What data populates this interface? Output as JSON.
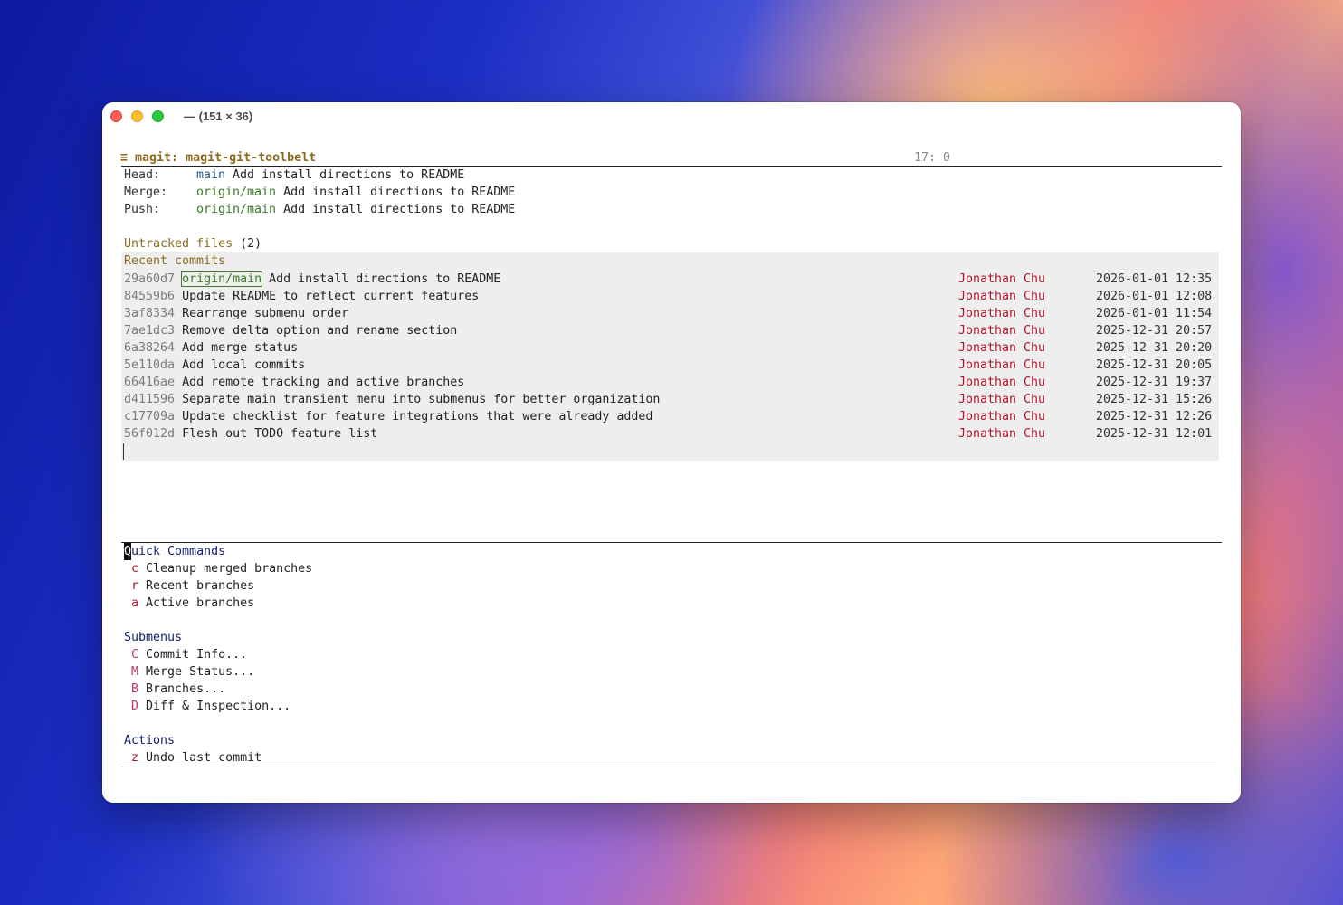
{
  "window": {
    "title": "— (151 × 36)"
  },
  "modeline": {
    "icon": "≡",
    "buffer": "magit: magit-git-toolbelt",
    "position": "17: 0"
  },
  "refs": {
    "head": {
      "label": "Head:",
      "branch": "main",
      "message": "Add install directions to README"
    },
    "merge": {
      "label": "Merge:",
      "branch": "origin/main",
      "message": "Add install directions to README"
    },
    "push": {
      "label": "Push:",
      "branch": "origin/main",
      "message": "Add install directions to README"
    }
  },
  "sections": {
    "untracked_title": "Untracked files",
    "untracked_count": "(2)",
    "recent_title": "Recent commits"
  },
  "commits": [
    {
      "hash": "29a60d7",
      "ref": "origin/main",
      "message": "Add install directions to README",
      "author": "Jonathan Chu",
      "date": "2026-01-01 12:35"
    },
    {
      "hash": "84559b6",
      "ref": "",
      "message": "Update README to reflect current features",
      "author": "Jonathan Chu",
      "date": "2026-01-01 12:08"
    },
    {
      "hash": "3af8334",
      "ref": "",
      "message": "Rearrange submenu order",
      "author": "Jonathan Chu",
      "date": "2026-01-01 11:54"
    },
    {
      "hash": "7ae1dc3",
      "ref": "",
      "message": "Remove delta option and rename section",
      "author": "Jonathan Chu",
      "date": "2025-12-31 20:57"
    },
    {
      "hash": "6a38264",
      "ref": "",
      "message": "Add merge status",
      "author": "Jonathan Chu",
      "date": "2025-12-31 20:20"
    },
    {
      "hash": "5e110da",
      "ref": "",
      "message": "Add local commits",
      "author": "Jonathan Chu",
      "date": "2025-12-31 20:05"
    },
    {
      "hash": "66416ae",
      "ref": "",
      "message": "Add remote tracking and active branches",
      "author": "Jonathan Chu",
      "date": "2025-12-31 19:37"
    },
    {
      "hash": "d411596",
      "ref": "",
      "message": "Separate main transient menu into submenus for better organization",
      "author": "Jonathan Chu",
      "date": "2025-12-31 15:26"
    },
    {
      "hash": "c17709a",
      "ref": "",
      "message": "Update checklist for feature integrations that were already added",
      "author": "Jonathan Chu",
      "date": "2025-12-31 12:26"
    },
    {
      "hash": "56f012d",
      "ref": "",
      "message": "Flesh out TODO feature list",
      "author": "Jonathan Chu",
      "date": "2025-12-31 12:01"
    }
  ],
  "transient": {
    "quick_title_first": "Q",
    "quick_title_rest": "uick Commands",
    "quick": [
      {
        "key": "c",
        "label": "Cleanup merged branches"
      },
      {
        "key": "r",
        "label": "Recent branches"
      },
      {
        "key": "a",
        "label": "Active branches"
      }
    ],
    "submenus_title": "Submenus",
    "submenus": [
      {
        "key": "C",
        "label": "Commit Info..."
      },
      {
        "key": "M",
        "label": "Merge Status..."
      },
      {
        "key": "B",
        "label": "Branches..."
      },
      {
        "key": "D",
        "label": "Diff & Inspection..."
      }
    ],
    "actions_title": "Actions",
    "actions": [
      {
        "key": "z",
        "label": "Undo last commit"
      }
    ]
  },
  "colors": {
    "author": "#b3142a",
    "section_heading": "#8b6a1e",
    "transient_heading": "#15206e",
    "branch_local": "#2b5b8c",
    "branch_remote": "#3c7a2a"
  }
}
